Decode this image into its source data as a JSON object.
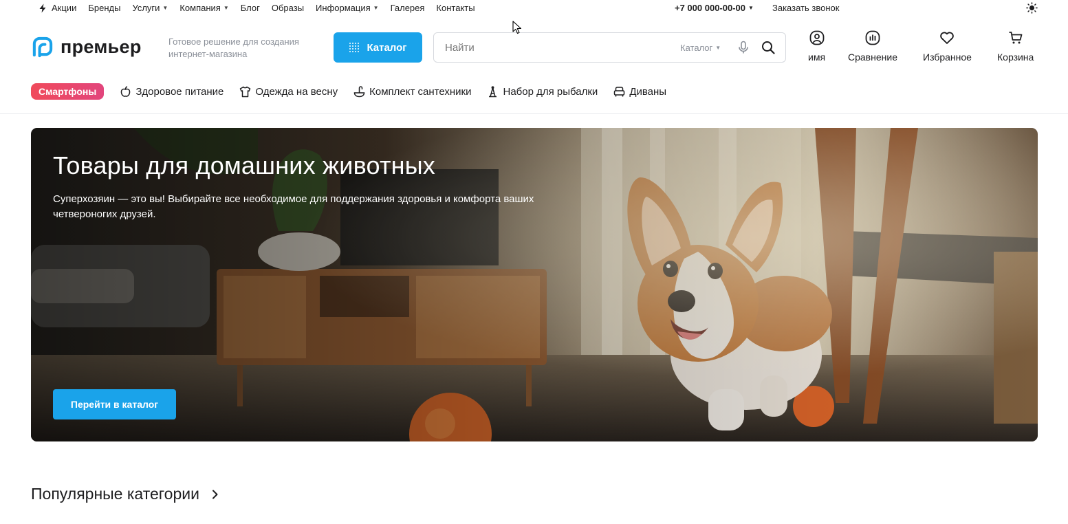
{
  "topbar": {
    "nav": [
      {
        "label": "Акции",
        "icon": "bolt-icon"
      },
      {
        "label": "Бренды"
      },
      {
        "label": "Услуги",
        "dropdown": true
      },
      {
        "label": "Компания",
        "dropdown": true
      },
      {
        "label": "Блог"
      },
      {
        "label": "Образы"
      },
      {
        "label": "Информация",
        "dropdown": true
      },
      {
        "label": "Галерея"
      },
      {
        "label": "Контакты"
      }
    ],
    "phone": "+7 000 000-00-00",
    "callback": "Заказать звонок",
    "theme_icon": "sun-icon"
  },
  "header": {
    "logo_text": "премьер",
    "tagline": "Готовое решение для создания интернет-магазина",
    "catalog_label": "Каталог",
    "search": {
      "placeholder": "Найти",
      "scope": "Каталог"
    },
    "actions": [
      {
        "label": "имя",
        "icon": "user-icon"
      },
      {
        "label": "Сравнение",
        "icon": "compare-icon"
      },
      {
        "label": "Избранное",
        "icon": "heart-icon"
      },
      {
        "label": "Корзина",
        "icon": "cart-icon"
      }
    ]
  },
  "category_strip": {
    "badge": "Смартфоны",
    "items": [
      {
        "label": "Здоровое питание",
        "icon": "apple-icon"
      },
      {
        "label": "Одежда на весну",
        "icon": "shirt-icon"
      },
      {
        "label": "Комплект сантехники",
        "icon": "faucet-icon"
      },
      {
        "label": "Набор для рыбалки",
        "icon": "fishing-icon"
      },
      {
        "label": "Диваны",
        "icon": "sofa-icon"
      }
    ]
  },
  "banner": {
    "title": "Товары для домашних животных",
    "text": "Суперхозяин — это вы! Выбирайте все необходимое для поддержания здоровья и комфорта ваших четвероногих друзей.",
    "button": "Перейти в каталог"
  },
  "popular": {
    "title": "Популярные категории"
  },
  "colors": {
    "accent": "#1aa3ea",
    "badge": "#e9406f",
    "text": "#1d1d1f",
    "muted": "#8a8f98"
  }
}
